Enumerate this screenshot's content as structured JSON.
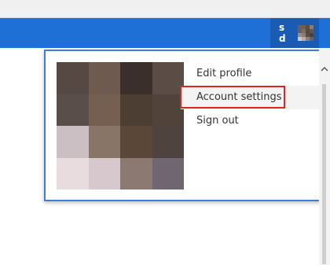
{
  "header": {
    "user_initials": "s d",
    "user_avatar_icon": "user-avatar-thumbnail",
    "bar_color": "#1e6fd6",
    "user_button_color": "#1a5bb3"
  },
  "profile_menu": {
    "profile_photo": "profile-photo",
    "items": [
      {
        "label": "Edit profile"
      },
      {
        "label": "Account settings",
        "highlighted": true
      },
      {
        "label": "Sign out"
      }
    ],
    "highlight_color": "#d9262a",
    "border_color": "#3a7fdc"
  },
  "scrollbar": {
    "up_arrow_icon": "chevron-up-icon"
  }
}
